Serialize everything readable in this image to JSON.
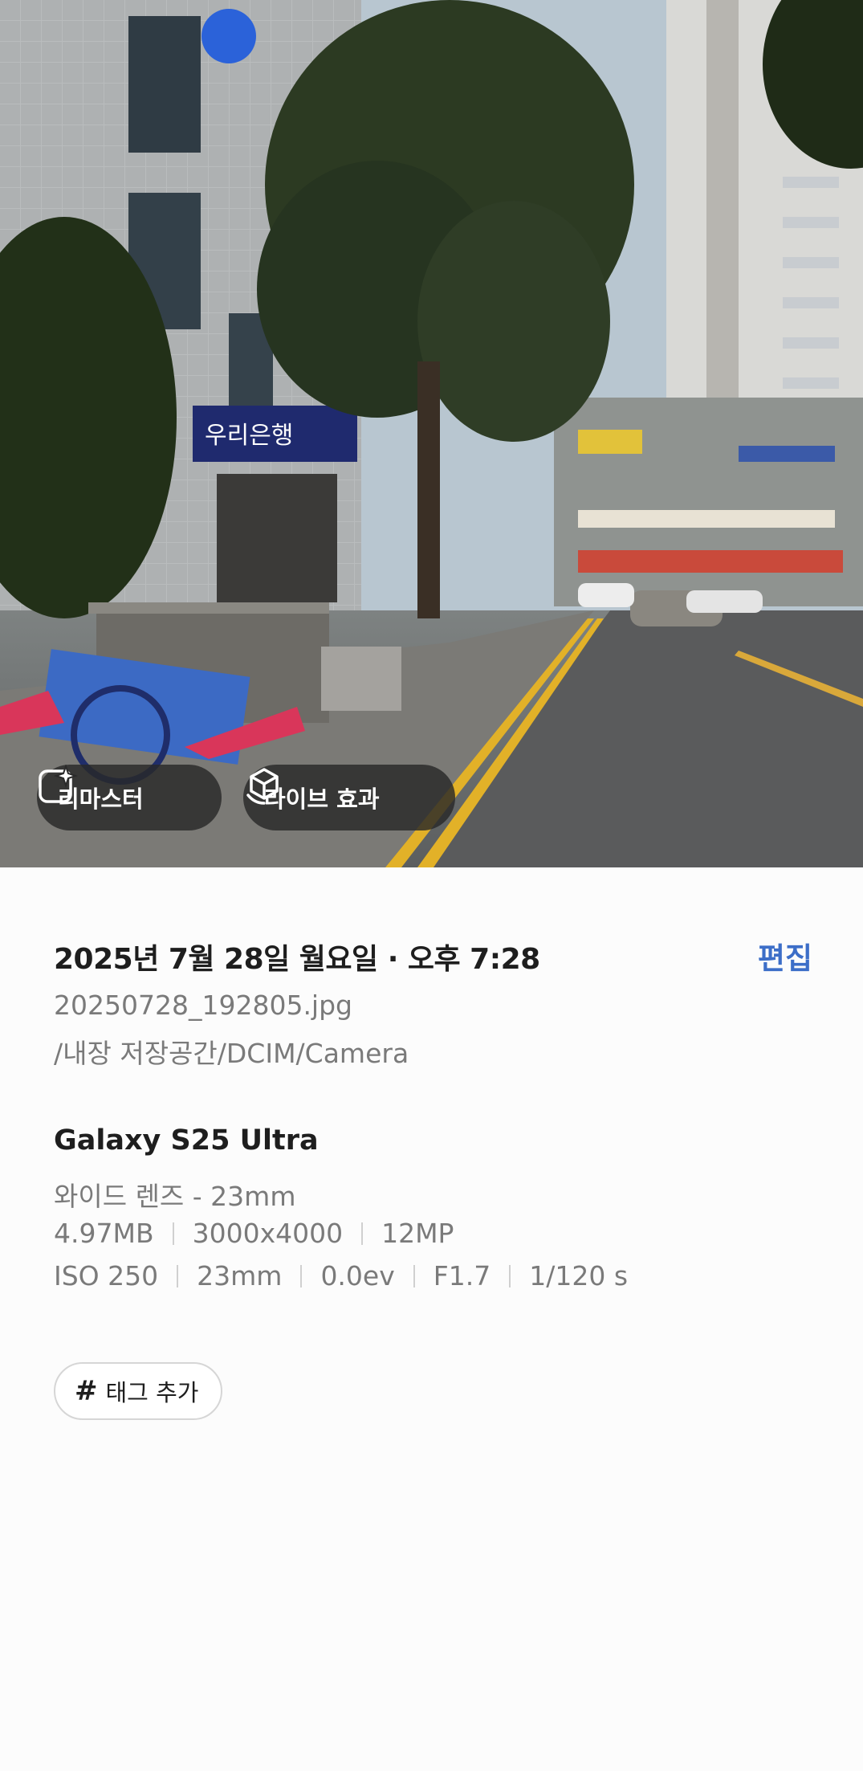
{
  "photo": {
    "remaster_label": "리마스터",
    "live_effect_label": "라이브 효과"
  },
  "details": {
    "datetime": "2025년 7월 28일 월요일 · 오후 7:28",
    "edit_label": "편집",
    "filename": "20250728_192805.jpg",
    "path": "/내장 저장공간/DCIM/Camera",
    "device": "Galaxy S25 Ultra",
    "lens": "와이드 렌즈 - 23mm",
    "file_info": [
      "4.97MB",
      "3000x4000",
      "12MP"
    ],
    "exif": [
      "ISO 250",
      "23mm",
      "0.0ev",
      "F1.7",
      "1/120 s"
    ]
  },
  "tag": {
    "label": "태그 추가"
  }
}
